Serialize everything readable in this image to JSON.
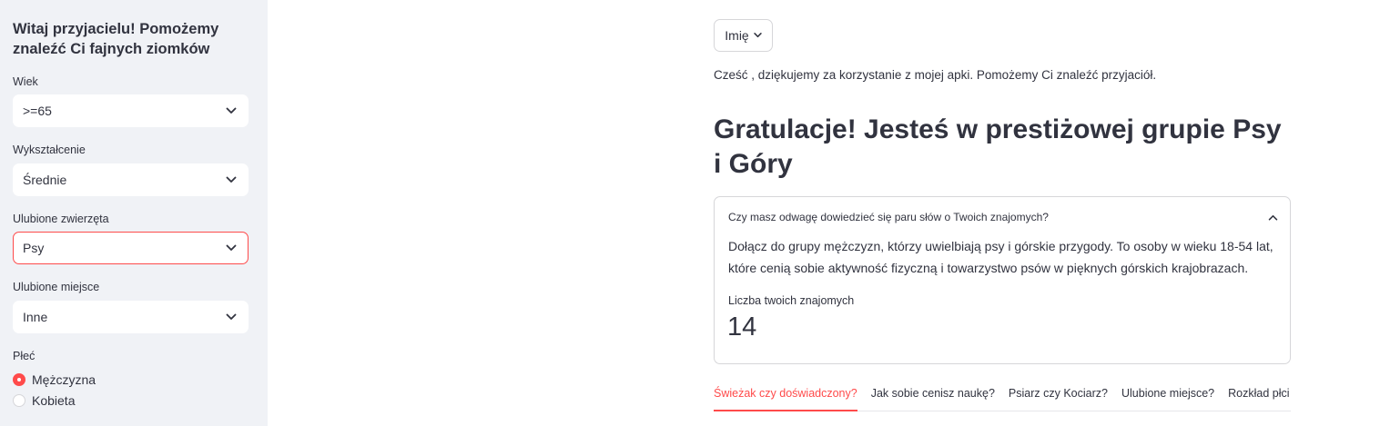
{
  "sidebar": {
    "title": "Witaj przyjacielu! Pomożemy znaleźć Ci fajnych ziomków",
    "fields": [
      {
        "label": "Wiek",
        "value": "&gt;=65"
      },
      {
        "label": "Wykształcenie",
        "value": "Średnie"
      },
      {
        "label": "Ulubione zwierzęta",
        "value": "Psy"
      },
      {
        "label": "Ulubione miejsce",
        "value": "Inne"
      }
    ],
    "gender": {
      "label": "Płeć",
      "options": [
        "Mężczyzna",
        "Kobieta"
      ],
      "selected": "Mężczyzna"
    }
  },
  "main": {
    "name_button": "Imię",
    "greeting": "Cześć , dziękujemy za korzystanie z mojej apki. Pomożemy Ci znaleźć przyjaciół.",
    "headline": "Gratulacje! Jesteś w prestiżowej grupie Psy i Góry",
    "expander": {
      "title": "Czy masz odwagę dowiedzieć się paru słów o Twoich znajomych?",
      "body": "Dołącz do grupy mężczyzn, którzy uwielbiają psy i górskie przygody. To osoby w wieku 18-54 lat, które cenią sobie aktywność fizyczną i towarzystwo psów w pięknych górskich krajobrazach.",
      "metric_label": "Liczba twoich znajomych",
      "metric_value": "14"
    },
    "tabs": [
      "Świeżak czy doświadczony?",
      "Jak sobie cenisz naukę?",
      "Psiarz czy Kociarz?",
      "Ulubione miejsce?",
      "Rozkład płci"
    ],
    "active_tab": 0
  },
  "colors": {
    "accent": "#ff4b4b",
    "sidebar_bg": "#f0f2f6",
    "text": "#31333f",
    "border": "#d6d6d9"
  }
}
